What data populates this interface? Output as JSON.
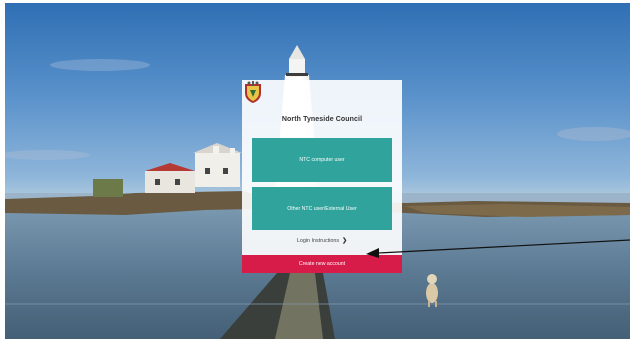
{
  "login": {
    "organisation_name": "North Tyneside Council",
    "option_1": "NTC computer user",
    "option_2": "Other NTC user/External User",
    "instructions_link": "Login Instructions",
    "create_account": "Create new account"
  },
  "icons": {
    "crest": "council-crest-icon",
    "chevron": "chevron-right-icon",
    "arrow": "pointer-arrow-icon"
  },
  "colors": {
    "tile": "#2fa39c",
    "create_button": "#d81c4a",
    "panel": "#ffffff"
  }
}
